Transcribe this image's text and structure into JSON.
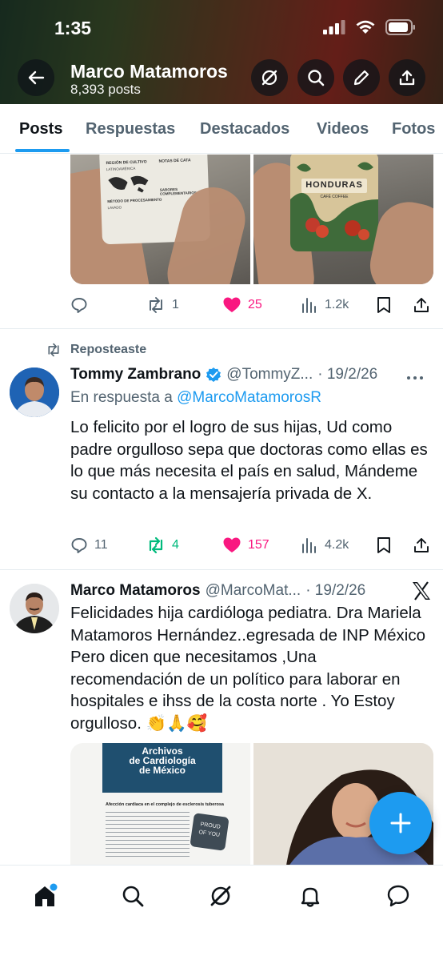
{
  "status_bar": {
    "time": "1:35"
  },
  "profile": {
    "name": "Marco Matamoros",
    "posts_count": "8,393 posts"
  },
  "tabs": [
    {
      "label": "Posts",
      "active": true
    },
    {
      "label": "Respuestas"
    },
    {
      "label": "Destacados"
    },
    {
      "label": "Videos"
    },
    {
      "label": "Fotos"
    }
  ],
  "post1": {
    "media": [
      {
        "icon": "coffee-card-map-image",
        "lines": [
          "REGIÓN DE CULTIVO",
          "LATINOAMÉRICA",
          "NOTAS DE CATA",
          "MÉTODO DE PROCESAMIENTO",
          "LAVADO",
          "SABORES COMPLEMENTARIOS"
        ]
      },
      {
        "icon": "honduras-coffee-card-image",
        "title": "HONDURAS",
        "subtitle": "CAFÉ COFFEE"
      }
    ],
    "stats": {
      "replies": "",
      "reposts": "1",
      "likes": "25",
      "views": "1.2k"
    }
  },
  "post2": {
    "repost_label": "Reposteaste",
    "author": "Tommy Zambrano",
    "handle": "@TommyZ...",
    "date": "· 19/2/26",
    "reply_prefix": "En respuesta a",
    "reply_to": "@MarcoMatamorosR",
    "text": "Lo felicito por el logro de sus hijas, Ud como padre orgulloso sepa que doctoras como ellas es lo que más necesita el país en salud, Mándeme su contacto a la mensajería privada de X.",
    "stats": {
      "replies": "11",
      "reposts": "4",
      "likes": "157",
      "views": "4.2k"
    }
  },
  "post3": {
    "author": "Marco Matamoros",
    "handle": "@MarcoMat...",
    "date": "· 19/2/26",
    "text": "Felicidades hija cardióloga pediatra. Dra Mariela Matamoros Hernández..egresada de INP México Pero dicen que necesitamos ,Una recomendación de un político para laborar en hospitales e ihss de la costa norte . Yo Estoy orgulloso. 👏🙏🥰",
    "journal": {
      "title_1": "Archivos",
      "title_2": "de Cardiología",
      "title_3": "de México",
      "section": "Afección cardiaca en el complejo de esclerosis tuberosa",
      "badge_1": "PROUD",
      "badge_2": "OF YOU"
    }
  },
  "colors": {
    "accent": "#1d9bf0",
    "like": "#f91880",
    "repost_active": "#00ba7c",
    "muted": "#536471"
  }
}
